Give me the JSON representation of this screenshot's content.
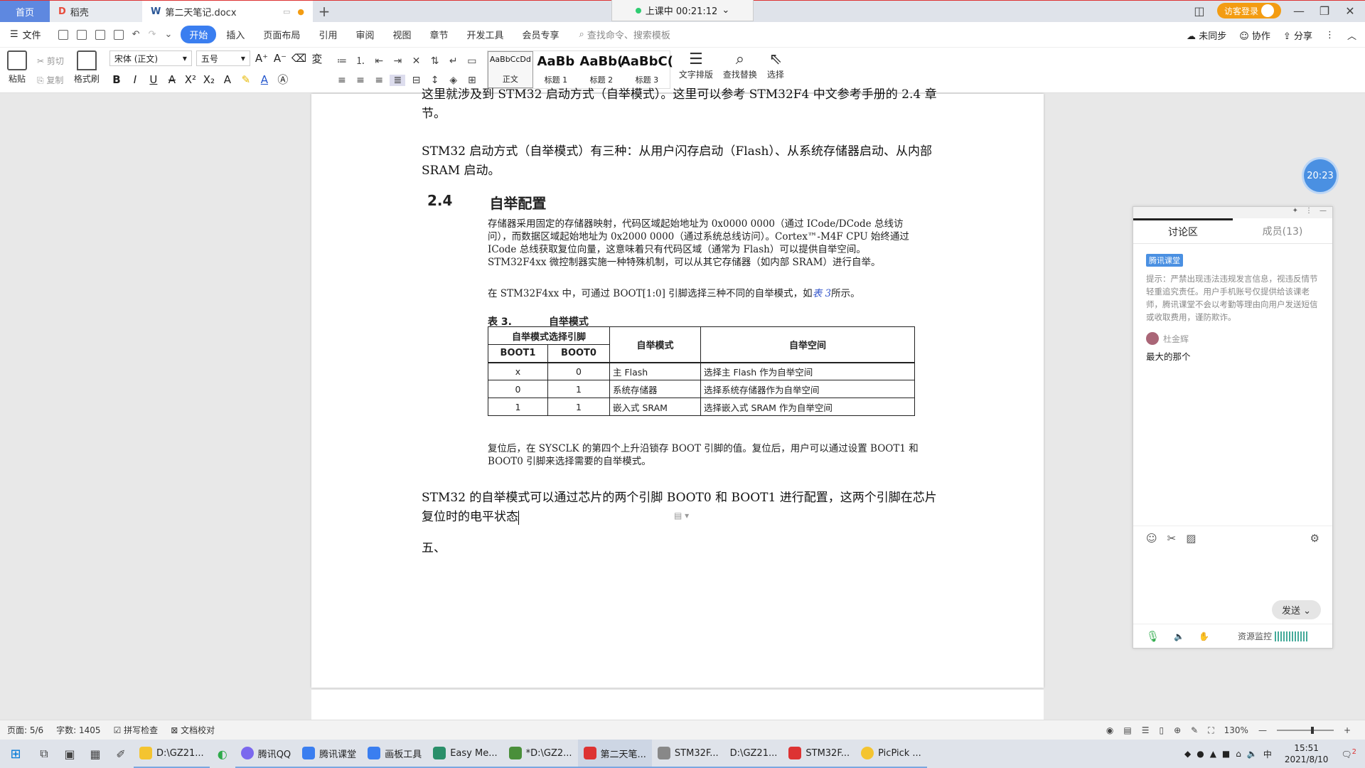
{
  "titlebar": {
    "home_tab": "首页",
    "doc_tab": "稻壳",
    "active_tab": "第二天笔记.docx",
    "add_tab": "+",
    "class_status": "上课中 00:21:12",
    "guest_login": "访客登录"
  },
  "menu": {
    "file": "文件",
    "items": [
      "开始",
      "插入",
      "页面布局",
      "引用",
      "审阅",
      "视图",
      "章节",
      "开发工具",
      "会员专享"
    ],
    "search_placeholder": "查找命令、搜索模板",
    "sync": "未同步",
    "collab": "协作",
    "share": "分享"
  },
  "ribbon": {
    "paste": "粘贴",
    "cut": "剪切",
    "copy": "复制",
    "format_painter": "格式刷",
    "font_name": "宋体 (正文)",
    "font_size": "五号",
    "styles": [
      {
        "sample": "AaBbCcDd",
        "label": "正文"
      },
      {
        "sample": "AaBb",
        "label": "标题 1"
      },
      {
        "sample": "AaBb(",
        "label": "标题 2"
      },
      {
        "sample": "AaBbC(",
        "label": "标题 3"
      }
    ],
    "text_layout": "文字排版",
    "find_replace": "查找替换",
    "select": "选择"
  },
  "document": {
    "line1": "这里就涉及到 STM32 启动方式（自举模式）。这里可以参考 STM32F4 中文参考手册的 2.4 章节。",
    "para_boot": "STM32 启动方式（自举模式）有三种：从用户闪存启动（Flash）、从系统存储器启动、从内部 SRAM 启动。",
    "section_num": "2.4",
    "section_title": "自举配置",
    "snip1": "存储器采用固定的存储器映射，代码区域起始地址为 0x0000 0000（通过 ICode/DCode 总线访问），而数据区域起始地址为 0x2000 0000（通过系统总线访问）。Cortex™-M4F CPU 始终通过 ICode 总线获取复位向量，这意味着只有代码区域（通常为 Flash）可以提供自举空间。STM32F4xx 微控制器实施一种特殊机制，可以从其它存储器（如内部 SRAM）进行自举。",
    "snip2_pre": "在 STM32F4xx 中，可通过 BOOT[1:0] 引脚选择三种不同的自举模式，如",
    "snip2_link": "表 3",
    "snip2_post": "所示。",
    "table_num": "表 3.",
    "table_title": "自举模式",
    "table": {
      "group_header": "自举模式选择引脚",
      "h_boot1": "BOOT1",
      "h_boot0": "BOOT0",
      "h_mode": "自举模式",
      "h_space": "自举空间",
      "rows": [
        {
          "boot1": "x",
          "boot0": "0",
          "mode": "主 Flash",
          "space": "选择主 Flash 作为自举空间"
        },
        {
          "boot1": "0",
          "boot0": "1",
          "mode": "系统存储器",
          "space": "选择系统存储器作为自举空间"
        },
        {
          "boot1": "1",
          "boot0": "1",
          "mode": "嵌入式 SRAM",
          "space": "选择嵌入式 SRAM 作为自举空间"
        }
      ]
    },
    "snip3": "复位后，在 SYSCLK 的第四个上升沿锁存 BOOT 引脚的值。复位后，用户可以通过设置 BOOT1 和 BOOT0 引脚来选择需要的自举模式。",
    "para_config": "STM32 的自举模式可以通过芯片的两个引脚 BOOT0 和 BOOT1 进行配置，这两个引脚在芯片复位时的电平状态",
    "para_five": "五、"
  },
  "timer": "20:23",
  "discussion": {
    "tab_discussion": "讨论区",
    "tab_members": "成员(13)",
    "badge": "腾讯课堂",
    "notice": "提示：严禁出现违法违规发言信息，视违反情节轻重追究责任。用户手机账号仅提供给该课老师，腾讯课堂不会以考勤等理由向用户发送短信或收取费用，谨防欺诈。",
    "user": "杜金辉",
    "message": "最大的那个",
    "send": "发送",
    "resource_monitor": "资源监控"
  },
  "statusbar": {
    "page": "页面: 5/6",
    "words": "字数: 1405",
    "spell": "拼写检查",
    "proof": "文档校对",
    "zoom": "130%"
  },
  "taskbar": {
    "apps": [
      {
        "label": "D:\\GZ21...",
        "color": "#f4c430"
      },
      {
        "label": "腾讯QQ",
        "color": "#7b68ee"
      },
      {
        "label": "腾讯课堂",
        "color": "#3a7ef0"
      },
      {
        "label": "画板工具",
        "color": "#3a7ef0"
      },
      {
        "label": "Easy Me...",
        "color": "#2a8f6a"
      },
      {
        "label": "*D:\\GZ2...",
        "color": "#4a8f3a"
      },
      {
        "label": "第二天笔...",
        "color": "#d33"
      },
      {
        "label": "STM32F...",
        "color": "#888"
      },
      {
        "label": "D:\\GZ21...",
        "color": "#f4c430"
      },
      {
        "label": "STM32F...",
        "color": "#d33"
      },
      {
        "label": "PicPick ...",
        "color": "#f4c430"
      }
    ],
    "ime": "中",
    "time": "15:51",
    "date": "2021/8/10",
    "notifications": "2"
  }
}
